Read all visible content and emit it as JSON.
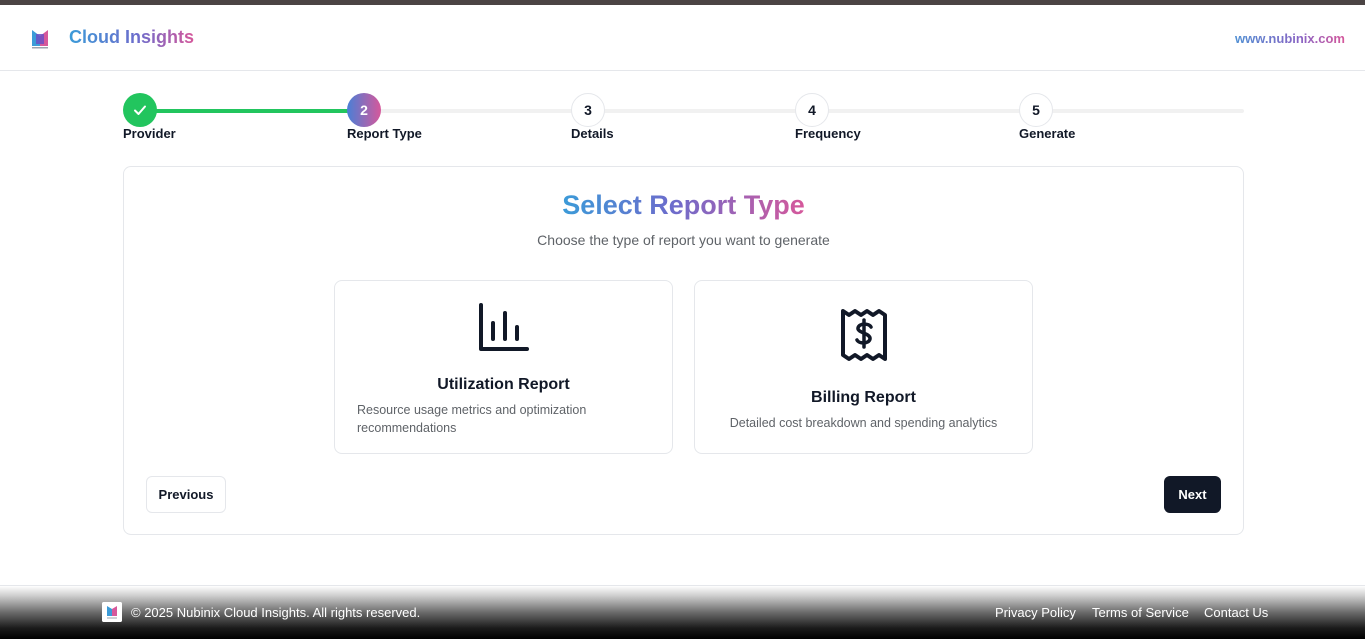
{
  "header": {
    "brand": "Cloud Insights",
    "site_link": "www.nubinix.com"
  },
  "stepper": {
    "steps": [
      {
        "number": "",
        "label": "Provider",
        "status": "completed"
      },
      {
        "number": "2",
        "label": "Report Type",
        "status": "active"
      },
      {
        "number": "3",
        "label": "Details",
        "status": "pending"
      },
      {
        "number": "4",
        "label": "Frequency",
        "status": "pending"
      },
      {
        "number": "5",
        "label": "Generate",
        "status": "pending"
      }
    ],
    "progress_fraction": 0.2
  },
  "main": {
    "title": "Select Report Type",
    "subtitle": "Choose the type of report you want to generate",
    "options": [
      {
        "icon": "bar-chart-icon",
        "title": "Utilization Report",
        "description": "Resource usage metrics and optimization recommendations"
      },
      {
        "icon": "billing-receipt-icon",
        "title": "Billing Report",
        "description": "Detailed cost breakdown and spending analytics"
      }
    ],
    "previous_label": "Previous",
    "next_label": "Next"
  },
  "footer": {
    "copyright": "© 2025 Nubinix Cloud Insights. All rights reserved.",
    "links": [
      "Privacy Policy",
      "Terms of Service",
      "Contact Us"
    ]
  },
  "colors": {
    "success": "#22c55e",
    "primary_dark": "#111827",
    "gradient_start": "#3b9bd8",
    "gradient_mid": "#6c6ccc",
    "gradient_end": "#d6589b"
  }
}
